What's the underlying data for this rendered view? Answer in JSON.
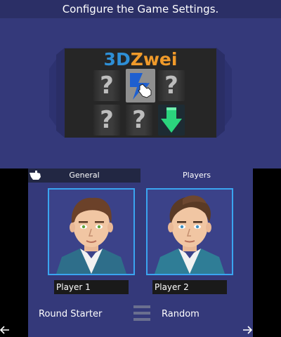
{
  "top_screen": {
    "instruction": "Configure the Game Settings.",
    "logo": {
      "part1": "3D",
      "part2": "Zwei"
    },
    "tiles": [
      "?",
      "lightning-icon",
      "?",
      "?",
      "?",
      "down-arrow-icon"
    ]
  },
  "tabs": {
    "general": "General",
    "players": "Players"
  },
  "players": [
    {
      "name": "Player 1"
    },
    {
      "name": "Player 2"
    }
  ],
  "settings": {
    "round_starter_label": "Round Starter",
    "round_starter_value": "Random"
  },
  "colors": {
    "background": "#34397a",
    "frame_border": "#3aa5f0",
    "logo_blue": "#2e8fd6",
    "logo_orange": "#f09a2a",
    "arrow_green": "#2bd47d"
  }
}
